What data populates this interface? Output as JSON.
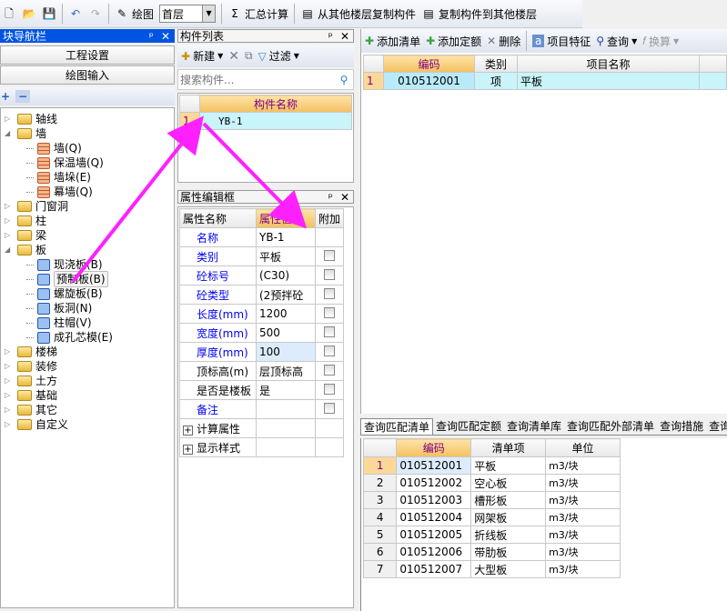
{
  "toolbar": {
    "draw_label": "绘图",
    "floor": "首层",
    "sum_label": "汇总计算",
    "copy_from": "从其他楼层复制构件",
    "copy_to": "复制构件到其他楼层"
  },
  "nav": {
    "title": "块导航栏",
    "btn_project": "工程设置",
    "btn_draw": "绘图输入",
    "tree": [
      {
        "label": "轴线",
        "type": "folder",
        "expanded": false,
        "level": 0
      },
      {
        "label": "墙",
        "type": "folder",
        "expanded": true,
        "level": 0
      },
      {
        "label": "墙(Q)",
        "type": "brick",
        "level": 1
      },
      {
        "label": "保温墙(Q)",
        "type": "brick",
        "level": 1
      },
      {
        "label": "墙垛(E)",
        "type": "brick",
        "level": 1
      },
      {
        "label": "幕墙(Q)",
        "type": "brick",
        "level": 1
      },
      {
        "label": "门窗洞",
        "type": "folder",
        "expanded": false,
        "level": 0
      },
      {
        "label": "柱",
        "type": "folder",
        "expanded": false,
        "level": 0
      },
      {
        "label": "梁",
        "type": "folder",
        "expanded": false,
        "level": 0
      },
      {
        "label": "板",
        "type": "folder",
        "expanded": true,
        "level": 0
      },
      {
        "label": "现浇板(B)",
        "type": "slab",
        "level": 1
      },
      {
        "label": "预制板(B)",
        "type": "slab",
        "level": 1,
        "selected": true
      },
      {
        "label": "螺旋板(B)",
        "type": "slab",
        "level": 1
      },
      {
        "label": "板洞(N)",
        "type": "slab",
        "level": 1
      },
      {
        "label": "柱帽(V)",
        "type": "slab",
        "level": 1
      },
      {
        "label": "成孔芯模(E)",
        "type": "slab",
        "level": 1
      },
      {
        "label": "楼梯",
        "type": "folder",
        "expanded": false,
        "level": 0
      },
      {
        "label": "装修",
        "type": "folder",
        "expanded": false,
        "level": 0
      },
      {
        "label": "土方",
        "type": "folder",
        "expanded": false,
        "level": 0
      },
      {
        "label": "基础",
        "type": "folder",
        "expanded": false,
        "level": 0
      },
      {
        "label": "其它",
        "type": "folder",
        "expanded": false,
        "level": 0
      },
      {
        "label": "自定义",
        "type": "folder",
        "expanded": false,
        "level": 0
      }
    ]
  },
  "components": {
    "title": "构件列表",
    "new_label": "新建",
    "filter_label": "过滤",
    "search_placeholder": "搜索构件...",
    "col_name": "构件名称",
    "rows": [
      {
        "n": "1",
        "name": "YB-1"
      }
    ]
  },
  "props": {
    "title": "属性编辑框",
    "col_name": "属性名称",
    "col_value": "属性值",
    "col_extra": "附加",
    "rows": [
      {
        "name": "名称",
        "value": "YB-1",
        "blue": true,
        "cb": false
      },
      {
        "name": "类别",
        "value": "平板",
        "blue": true,
        "cb": true
      },
      {
        "name": "砼标号",
        "value": "(C30)",
        "blue": true,
        "cb": true
      },
      {
        "name": "砼类型",
        "value": "(2预拌砼",
        "blue": true,
        "cb": true
      },
      {
        "name": "长度(mm)",
        "value": "1200",
        "blue": true,
        "cb": true
      },
      {
        "name": "宽度(mm)",
        "value": "500",
        "blue": true,
        "cb": true
      },
      {
        "name": "厚度(mm)",
        "value": "100",
        "blue": true,
        "cb": true,
        "selected": true
      },
      {
        "name": "顶标高(m)",
        "value": "层顶标高",
        "blue": false,
        "cb": true
      },
      {
        "name": "是否是楼板",
        "value": "是",
        "blue": false,
        "cb": true
      },
      {
        "name": "备注",
        "value": "",
        "blue": true,
        "cb": true
      }
    ],
    "groups": [
      "计算属性",
      "显示样式"
    ]
  },
  "bill": {
    "add_list": "添加清单",
    "add_quota": "添加定额",
    "delete": "删除",
    "feature": "项目特征",
    "query": "查询",
    "convert": "换算",
    "cols": [
      "编码",
      "类别",
      "项目名称"
    ],
    "rows": [
      {
        "n": "1",
        "code": "010512001",
        "type": "项",
        "name": "平板"
      }
    ]
  },
  "query": {
    "tabs": [
      "查询匹配清单",
      "查询匹配定额",
      "查询清单库",
      "查询匹配外部清单",
      "查询措施",
      "查询"
    ],
    "cols": [
      "编码",
      "清单项",
      "单位"
    ],
    "rows": [
      {
        "n": "1",
        "code": "010512001",
        "item": "平板",
        "unit": "m3/块"
      },
      {
        "n": "2",
        "code": "010512002",
        "item": "空心板",
        "unit": "m3/块"
      },
      {
        "n": "3",
        "code": "010512003",
        "item": "槽形板",
        "unit": "m3/块"
      },
      {
        "n": "4",
        "code": "010512004",
        "item": "网架板",
        "unit": "m3/块"
      },
      {
        "n": "5",
        "code": "010512005",
        "item": "折线板",
        "unit": "m3/块"
      },
      {
        "n": "6",
        "code": "010512006",
        "item": "带肋板",
        "unit": "m3/块"
      },
      {
        "n": "7",
        "code": "010512007",
        "item": "大型板",
        "unit": "m3/块"
      }
    ]
  },
  "colors": {
    "active_title": "#0054e3",
    "arrow": "#ff20ff",
    "selected_row": "#c8f4fa",
    "header_selected": "#f4c060"
  }
}
